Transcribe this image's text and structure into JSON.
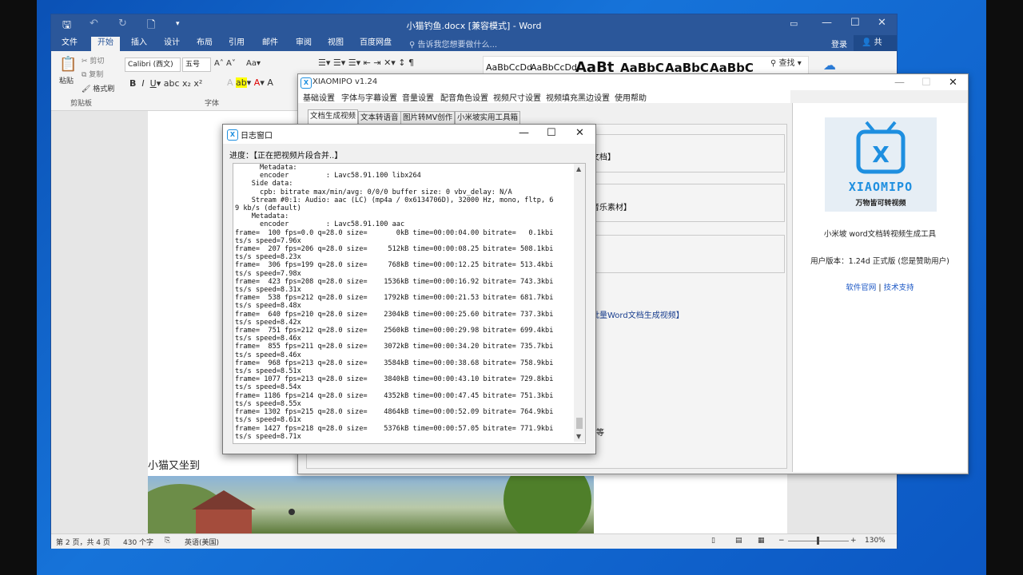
{
  "word": {
    "title": "小猫钓鱼.docx [兼容模式] - Word",
    "tabs": [
      "文件",
      "开始",
      "插入",
      "设计",
      "布局",
      "引用",
      "邮件",
      "审阅",
      "视图",
      "百度网盘"
    ],
    "active_tab": "开始",
    "tell_me": "告诉我您想要做什么...",
    "login": "登录",
    "share": "共享",
    "clipboard": {
      "paste": "粘贴",
      "cut": "剪切",
      "copy": "复制",
      "format_painter": "格式刷",
      "group": "剪贴板"
    },
    "font": {
      "name": "Calibri (西文)",
      "size": "五号",
      "group": "字体"
    },
    "styles": [
      "AaBbCcDd",
      "AaBbCcDd",
      "AaBt",
      "AaBbC",
      "AaBbC",
      "AaBbC"
    ],
    "editing": {
      "find": "查找"
    },
    "doc_text": "小猫又坐到",
    "status": {
      "page": "第 2 页，共 4 页",
      "words": "430 个字",
      "lang": "英语(美国)",
      "zoom": "130%"
    }
  },
  "xiaomipo": {
    "title": "XIAOMIPO v1.24",
    "menu": [
      "基础设置",
      "字体与字幕设置",
      "音量设置",
      "配音角色设置",
      "视频尺寸设置",
      "视频填充黑边设置",
      "使用帮助"
    ],
    "tabs": [
      "文档生成视频",
      "文本转语音",
      "图片转MV创作",
      "小米坡实用工具箱"
    ],
    "active_tab": "文档生成视频",
    "fragments": [
      "文档】",
      "音乐素材】",
      "批量Word文档生成视频】",
      "等"
    ],
    "logo_text": "XIAOMIPO",
    "logo_sub": "万物皆可转视频",
    "product": "小米坡 word文档转视频生成工具",
    "version": "用户版本：1.24d 正式版 (您是赞助用户)",
    "links": {
      "site": "软件官网",
      "sep": "|",
      "support": "技术支持"
    }
  },
  "log": {
    "title": "日志窗口",
    "progress": "进度：【正在把视频片段合并..】",
    "lines": [
      "      Metadata:",
      "      encoder         : Lavc58.91.100 libx264",
      "    Side data:",
      "      cpb: bitrate max/min/avg: 0/0/0 buffer size: 0 vbv_delay: N/A",
      "    Stream #0:1: Audio: aac (LC) (mp4a / 0x6134706D), 32000 Hz, mono, fltp, 6",
      "9 kb/s (default)",
      "    Metadata:",
      "      encoder         : Lavc58.91.100 aac",
      "frame=  100 fps=0.0 q=28.0 size=       0kB time=00:00:04.00 bitrate=   0.1kbi",
      "ts/s speed=7.96x",
      "frame=  207 fps=206 q=28.0 size=     512kB time=00:00:08.25 bitrate= 508.1kbi",
      "ts/s speed=8.23x",
      "frame=  306 fps=199 q=28.0 size=     768kB time=00:00:12.25 bitrate= 513.4kbi",
      "ts/s speed=7.98x",
      "frame=  423 fps=208 q=28.0 size=    1536kB time=00:00:16.92 bitrate= 743.3kbi",
      "ts/s speed=8.31x",
      "frame=  538 fps=212 q=28.0 size=    1792kB time=00:00:21.53 bitrate= 681.7kbi",
      "ts/s speed=8.48x",
      "frame=  640 fps=210 q=28.0 size=    2304kB time=00:00:25.60 bitrate= 737.3kbi",
      "ts/s speed=8.42x",
      "frame=  751 fps=212 q=28.0 size=    2560kB time=00:00:29.98 bitrate= 699.4kbi",
      "ts/s speed=8.46x",
      "frame=  855 fps=211 q=28.0 size=    3072kB time=00:00:34.20 bitrate= 735.7kbi",
      "ts/s speed=8.46x",
      "frame=  968 fps=213 q=28.0 size=    3584kB time=00:00:38.68 bitrate= 758.9kbi",
      "ts/s speed=8.51x",
      "frame= 1077 fps=213 q=28.0 size=    3840kB time=00:00:43.10 bitrate= 729.8kbi",
      "ts/s speed=8.54x",
      "frame= 1186 fps=214 q=28.0 size=    4352kB time=00:00:47.45 bitrate= 751.3kbi",
      "ts/s speed=8.55x",
      "frame= 1302 fps=215 q=28.0 size=    4864kB time=00:00:52.09 bitrate= 764.9kbi",
      "ts/s speed=8.61x",
      "frame= 1427 fps=218 q=28.0 size=    5376kB time=00:00:57.05 bitrate= 771.9kbi",
      "ts/s speed=8.71x"
    ]
  },
  "colors": {
    "word_blue": "#2b579a",
    "xiaomipo_blue": "#1e8fe0",
    "link": "#1a56c4"
  }
}
